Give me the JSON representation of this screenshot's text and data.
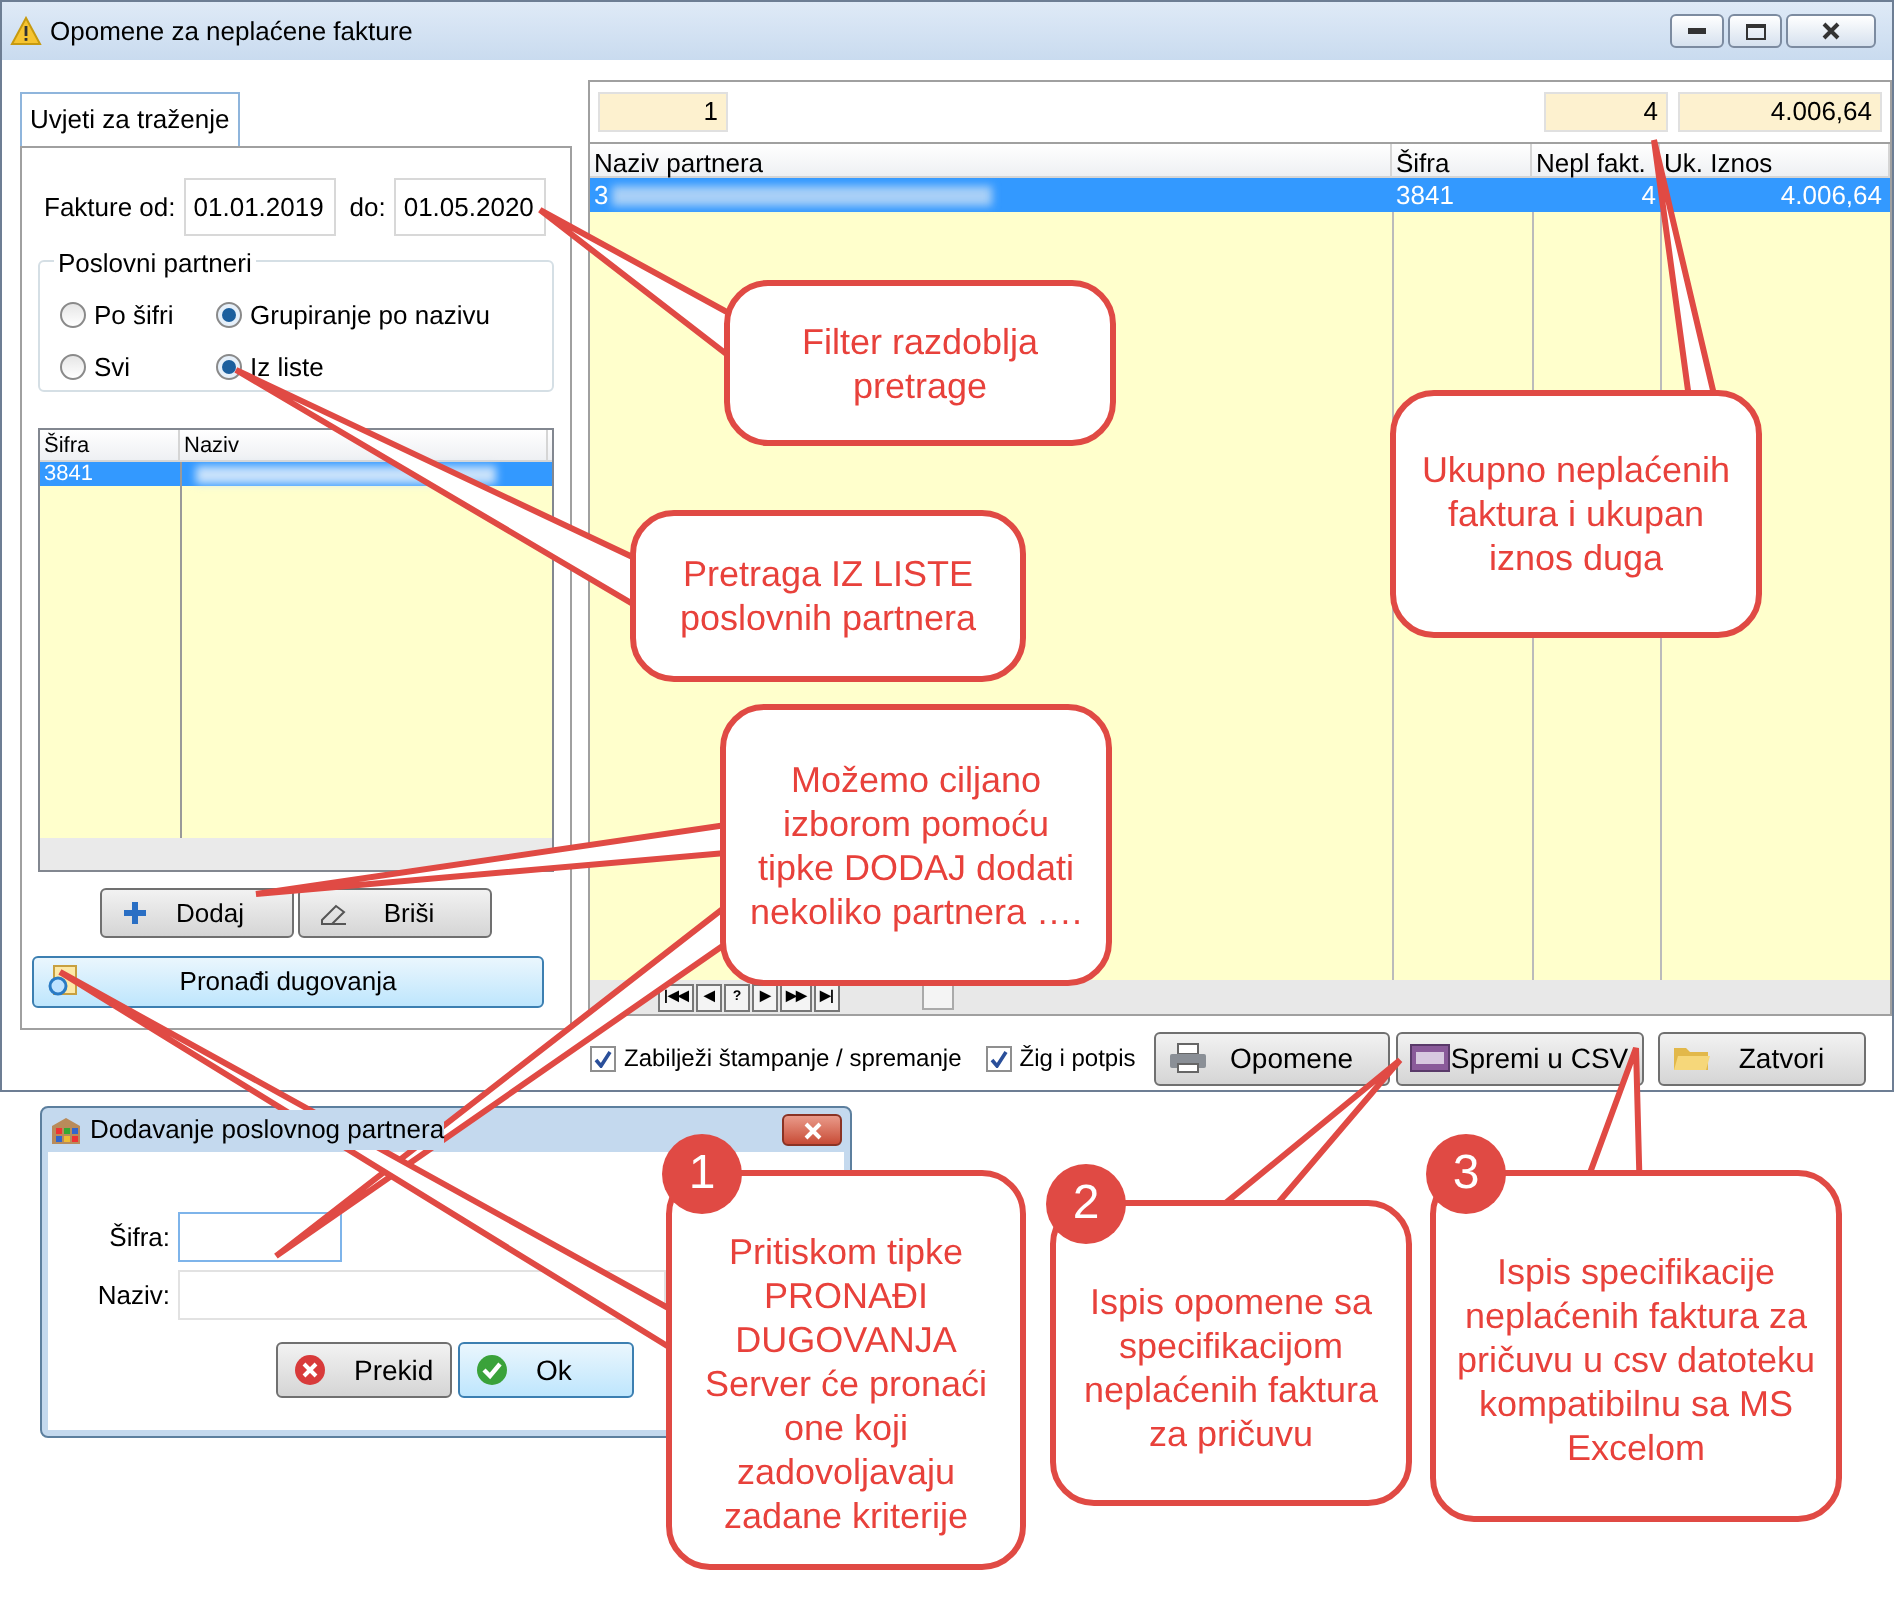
{
  "window": {
    "title": "Opomene za neplaćene fakture"
  },
  "search_tab": {
    "label": "Uvjeti za traženje",
    "selected": true
  },
  "date_filter": {
    "from_label": "Fakture od:",
    "from_value": "01.01.2019",
    "to_label": "do:",
    "to_value": "01.05.2020"
  },
  "partner_group": {
    "title": "Poslovni partneri",
    "options": [
      {
        "label": "Po šifri",
        "selected": false
      },
      {
        "label": "Grupiranje po nazivu",
        "selected": true
      },
      {
        "label": "Svi",
        "selected": false
      },
      {
        "label": "Iz liste",
        "selected": true
      }
    ]
  },
  "partner_list": {
    "columns": [
      "Šifra",
      "Naziv"
    ],
    "rows": [
      {
        "sifra": "3841",
        "selected": true
      }
    ]
  },
  "list_buttons": [
    "Dodaj",
    "Briši"
  ],
  "find_button": "Pronađi dugovanja",
  "summary": {
    "count": "1",
    "invoices": "4",
    "total": "4.006,64"
  },
  "table": {
    "columns": [
      "Naziv partnera",
      "Šifra",
      "Nepl fakt.",
      "Uk. Iznos"
    ],
    "rows": [
      {
        "name": "3",
        "sifra": "3841",
        "count": "4",
        "amount": "4.006,64",
        "selected": true
      }
    ]
  },
  "nav_buttons": [
    "|◀◀",
    "◀",
    "?",
    "▶",
    "▶▶",
    "▶|"
  ],
  "options": [
    {
      "label": "Zabilježi štampanje / spremanje",
      "checked": true
    },
    {
      "label": "Žig i potpis",
      "checked": true
    }
  ],
  "action_buttons": [
    {
      "kind": "print",
      "label": "Opomene"
    },
    {
      "kind": "csv",
      "label": "Spremi u CSV"
    },
    {
      "kind": "folder",
      "label": "Zatvori"
    }
  ],
  "dialog": {
    "title": "Dodavanje poslovnog partnera",
    "fields": [
      {
        "label": "Šifra:"
      },
      {
        "label": "Naziv:"
      }
    ],
    "buttons": [
      {
        "kind": "cancel",
        "label": "Prekid"
      },
      {
        "kind": "ok",
        "label": "Ok"
      }
    ]
  },
  "callouts": [
    {
      "text": "Filter razdoblja pretrage"
    },
    {
      "text": "Ukupno neplaćenih faktura i ukupan iznos duga"
    },
    {
      "text": "Pretraga IZ LISTE poslovnih partnera"
    },
    {
      "text": "Možemo ciljano izborom pomoću tipke DODAJ dodati nekoliko partnera …."
    },
    {
      "number": "1",
      "text": "Pritiskom tipke PRONAĐI DUGOVANJA Server će pronaći one koji zadovoljavaju zadane kriterije"
    },
    {
      "number": "2",
      "text": "Ispis opomene sa specifikacijom neplaćenih faktura za pričuvu"
    },
    {
      "number": "3",
      "text": "Ispis  specifikacije neplaćenih faktura za pričuvu u csv datoteku kompatibilnu sa MS Excelom"
    }
  ]
}
